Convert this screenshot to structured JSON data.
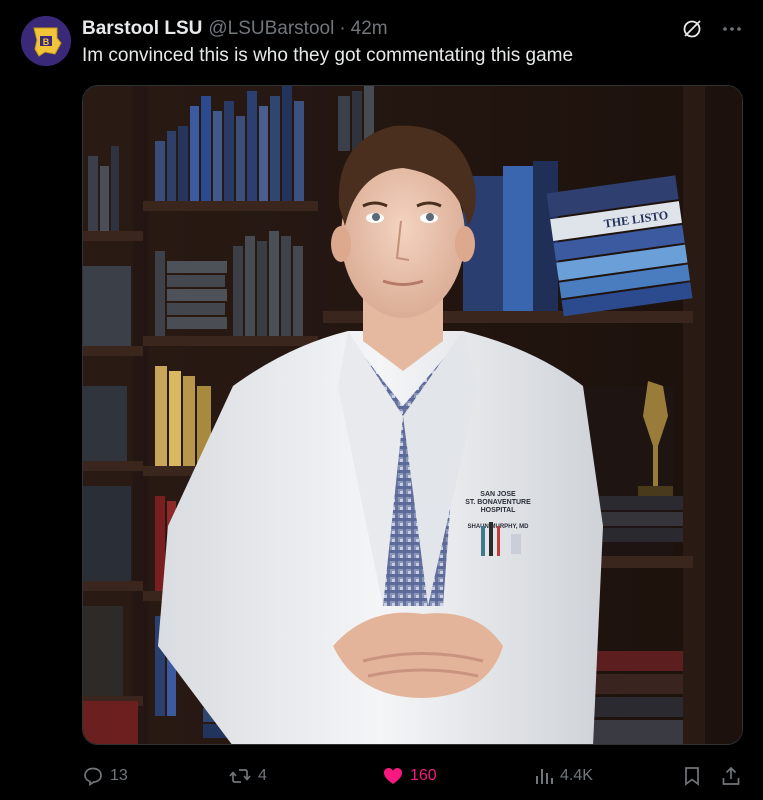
{
  "tweet": {
    "display_name": "Barstool LSU",
    "handle": "@LSUBarstool",
    "separator": "·",
    "time": "42m",
    "text": "Im convinced this is who they got commentating this game"
  },
  "media": {
    "image_description_icon": "photo",
    "coat_text": [
      "SAN JOSE",
      "ST. BONAVENTURE",
      "HOSPITAL"
    ],
    "name_tag": "SHAUN MURPHY, MD",
    "book_spine": "THE LISTO"
  },
  "actions": {
    "replies": "13",
    "reposts": "4",
    "likes": "160",
    "views": "4.4K"
  },
  "colors": {
    "background": "#000000",
    "text": "#e7e9ea",
    "muted": "#71767b",
    "like": "#f91880"
  }
}
